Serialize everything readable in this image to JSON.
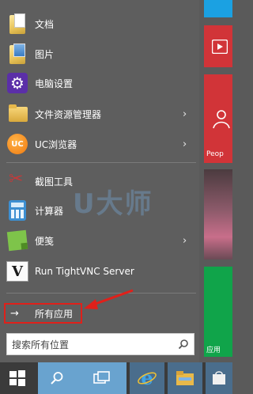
{
  "start_menu": {
    "apps": [
      {
        "label": "文档",
        "icon": "documents-folder-icon",
        "has_submenu": false
      },
      {
        "label": "图片",
        "icon": "pictures-folder-icon",
        "has_submenu": false
      },
      {
        "label": "电脑设置",
        "icon": "settings-gear-icon",
        "has_submenu": false
      },
      {
        "label": "文件资源管理器",
        "icon": "file-explorer-icon",
        "has_submenu": true
      },
      {
        "label": "UC浏览器",
        "icon": "uc-browser-icon",
        "has_submenu": true
      },
      {
        "label": "截图工具",
        "icon": "snipping-tool-icon",
        "has_submenu": false
      },
      {
        "label": "计算器",
        "icon": "calculator-icon",
        "has_submenu": false
      },
      {
        "label": "便笺",
        "icon": "sticky-notes-icon",
        "has_submenu": true
      },
      {
        "label": "Run TightVNC Server",
        "icon": "tightvnc-icon",
        "has_submenu": false
      }
    ],
    "submenu_glyph": "›",
    "all_apps": {
      "label": "所有应用",
      "glyph": "→"
    },
    "search": {
      "placeholder": "搜索所有位置"
    },
    "uc_icon_text": "UC",
    "vnc_icon_text": "V"
  },
  "watermark": "U大师",
  "tiles": {
    "people_label": "Peop",
    "store_label": "应用"
  },
  "colors": {
    "menu_bg": "#5e5e5e",
    "tile_blue": "#1ba1e2",
    "tile_red": "#d13438",
    "tile_green": "#10a44a",
    "highlight_red": "#e0201a",
    "taskbar_bg": "#3b3b3b"
  },
  "taskbar": {
    "items": [
      "windows-start-icon",
      "search-icon",
      "task-view-icon",
      "internet-explorer-icon",
      "file-explorer-icon",
      "store-icon"
    ]
  }
}
